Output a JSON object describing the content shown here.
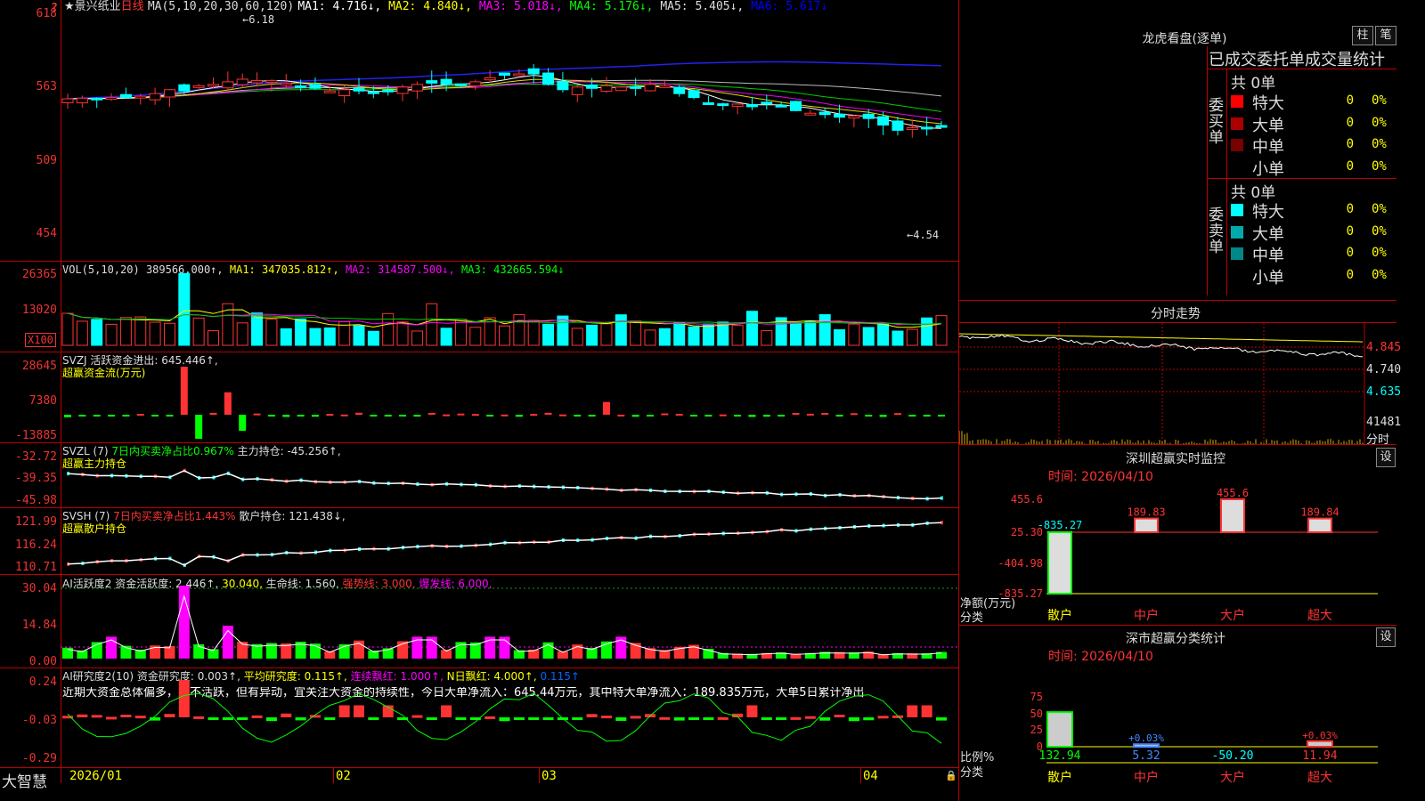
{
  "header": {
    "title": "★景兴纸业",
    "period": "日线",
    "ma_label": "MA(5,10,20,30,60,120)",
    "ma_values": [
      {
        "label": "MA1: 4.716↓,",
        "color": "#ffffff"
      },
      {
        "label": "MA2: 4.840↓,",
        "color": "#ffff00"
      },
      {
        "label": "MA3: 5.018↓,",
        "color": "#ff00ff"
      },
      {
        "label": "MA4: 5.176↓,",
        "color": "#00ff00"
      },
      {
        "label": "MA5: 5.405↓,",
        "color": "#dddddd"
      },
      {
        "label": "MA6: 5.617↓",
        "color": "#0000ff"
      }
    ]
  },
  "price_axis": [
    "618",
    "563",
    "509",
    "454"
  ],
  "price_marks": {
    "high": "6.18",
    "low": "4.54"
  },
  "vol": {
    "title": "VOL(5,10,20)",
    "value": "389566.000↑,",
    "ma1": "MA1: 347035.812↑,",
    "ma2": "MA2: 314587.500↓,",
    "ma3": "MA3: 432665.594↓",
    "axis": [
      "26365",
      "13020"
    ],
    "unit": "X100"
  },
  "svzj": {
    "title": "SVZJ  活跃资金进出: 645.446↑,",
    "subtitle": "超赢资金流(万元)",
    "axis": [
      "28645",
      "7380",
      "-13885"
    ]
  },
  "svzl": {
    "title": "SVZL (7)",
    "ratio": "7日内买卖净占比0.967%",
    "main": "主力持仓: -45.256↑,",
    "subtitle": "超赢主力持仓",
    "axis": [
      "-32.72",
      "-39.35",
      "-45.98"
    ]
  },
  "svsh": {
    "title": "SVSH (7)",
    "ratio": "7日内买卖净占比1.443%",
    "main": "散户持仓: 121.438↓,",
    "subtitle": "超赢散户持仓",
    "axis": [
      "121.99",
      "116.24",
      "110.71"
    ]
  },
  "ai1": {
    "title": "AI活跃度2 资金活跃度: 2.446↑,",
    "v2": "30.040,",
    "v3": "生命线: 1.560,",
    "v4": "强势线: 3.000,",
    "v5": "爆发线: 6.000,",
    "axis": [
      "30.04",
      "14.84",
      "0.00"
    ]
  },
  "ai2": {
    "title": "AI研究度2(10) 资金研究度: 0.003↑,",
    "v2": "平均研究度: 0.115↑,",
    "v3": "连续飘红: 1.000↑,",
    "v4": "N日飘红: 4.000↑,",
    "v5": "0.115↑",
    "note": "近期大资金总体偏多，虽不活跃，但有异动，宜关注大资金的持续性，今日大单净流入：645.44万元，其中特大单净流入：189.835万元，大单5日累计净出",
    "axis": [
      "0.24",
      "-0.03",
      "-0.29"
    ]
  },
  "xaxis": {
    "labels": [
      "2026/01",
      "02",
      "03",
      "04"
    ],
    "brand": "大智慧"
  },
  "right": {
    "dragon_title": "龙虎看盘(逐单)",
    "btn1": "柱",
    "btn2": "笔",
    "order_header": "已成交委托单成交量统计",
    "buy_label": "委买单",
    "sell_label": "委卖单",
    "buy_total": "共 0单",
    "sell_total": "共 0单",
    "buy_rows": [
      {
        "name": "特大",
        "count": "0",
        "pct": "0%",
        "color": "#ff0000"
      },
      {
        "name": "大单",
        "count": "0",
        "pct": "0%",
        "color": "#aa0000"
      },
      {
        "name": "中单",
        "count": "0",
        "pct": "0%",
        "color": "#770000"
      },
      {
        "name": "小单",
        "count": "0",
        "pct": "0%",
        "color": "#000000"
      }
    ],
    "sell_rows": [
      {
        "name": "特大",
        "count": "0",
        "pct": "0%",
        "color": "#00ffff"
      },
      {
        "name": "大单",
        "count": "0",
        "pct": "0%",
        "color": "#00aaaa"
      },
      {
        "name": "中单",
        "count": "0",
        "pct": "0%",
        "color": "#008888"
      },
      {
        "name": "小单",
        "count": "0",
        "pct": "0%",
        "color": "#000000"
      }
    ],
    "intraday_title": "分时走势",
    "intraday_axis": [
      "4.845",
      "4.740",
      "4.635",
      "41481"
    ],
    "intraday_unit": "分时",
    "sz_title": "深圳超赢实时监控",
    "sz_set": "设",
    "sz_time": "时间: 2026/04/10",
    "sz_axis": [
      "455.6",
      "25.30",
      "-404.98",
      "-835.27"
    ],
    "sz_bars": [
      {
        "cat": "散户",
        "value": "-835.27",
        "color": "#00ff00"
      },
      {
        "cat": "中户",
        "value": "189.83",
        "color": "#ff3333"
      },
      {
        "cat": "大户",
        "value": "455.6",
        "color": "#ff3333"
      },
      {
        "cat": "超大",
        "value": "189.84",
        "color": "#ff3333"
      }
    ],
    "sz_ylabel": "净额(万元)",
    "sz_xlabel": "分类",
    "cls_title": "深市超赢分类统计",
    "cls_set": "设",
    "cls_time": "时间: 2026/04/10",
    "cls_axis": [
      "75",
      "50",
      "25",
      "0"
    ],
    "cls_bars": [
      {
        "cat": "散户",
        "value": "132.94",
        "color": "#00ff00",
        "top": ""
      },
      {
        "cat": "中户",
        "value": "5.32",
        "color": "#4488ff",
        "top": "+0.03%"
      },
      {
        "cat": "大户",
        "value": "-50.20",
        "color": "#00ffff",
        "top": ""
      },
      {
        "cat": "超大",
        "value": "11.94",
        "color": "#ff3333",
        "top": "+0.03%"
      }
    ],
    "cls_ylabel": "比例%",
    "cls_xlabel": "分类"
  }
}
